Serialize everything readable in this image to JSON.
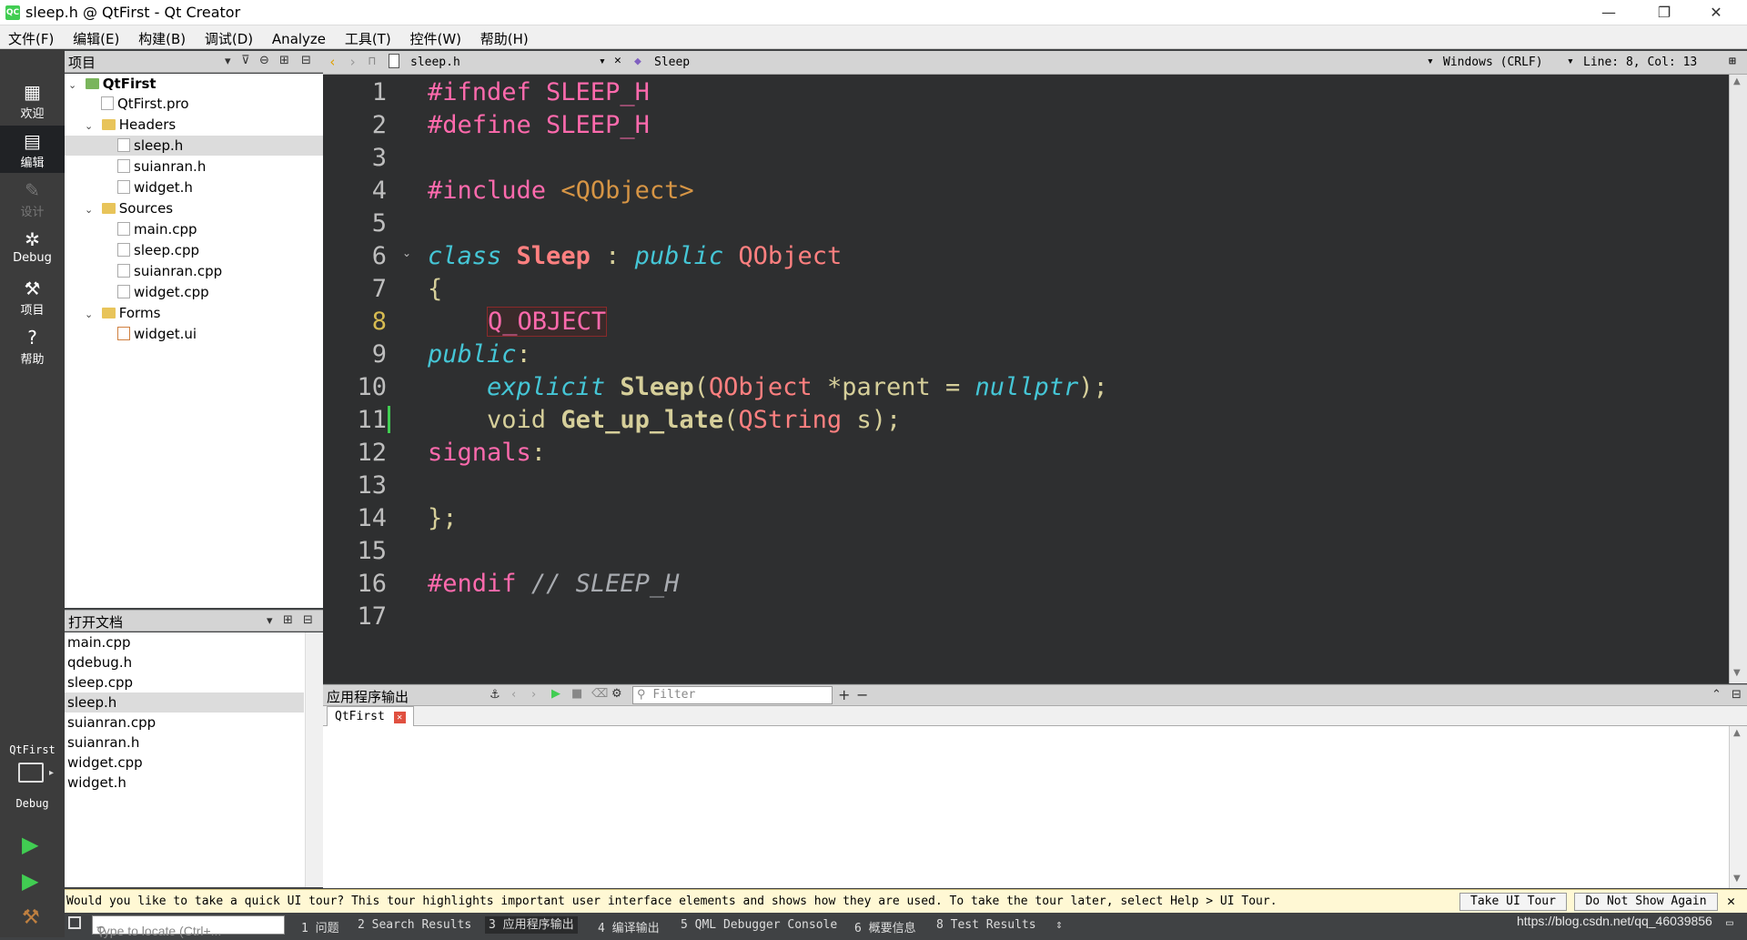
{
  "window": {
    "title": "sleep.h @ QtFirst - Qt Creator",
    "app_icon": "QC",
    "minimize": "—",
    "restore": "❐",
    "close": "✕"
  },
  "menu": [
    "文件(F)",
    "编辑(E)",
    "构建(B)",
    "调试(D)",
    "Analyze",
    "工具(T)",
    "控件(W)",
    "帮助(H)"
  ],
  "modes": [
    {
      "label": "欢迎",
      "icon": "grid-icon"
    },
    {
      "label": "编辑",
      "icon": "edit-icon"
    },
    {
      "label": "设计",
      "icon": "pencil-icon"
    },
    {
      "label": "Debug",
      "icon": "bug-icon"
    },
    {
      "label": "项目",
      "icon": "wrench-icon"
    },
    {
      "label": "帮助",
      "icon": "help-icon"
    }
  ],
  "kit": {
    "project": "QtFirst",
    "build": "Debug"
  },
  "project_panel": {
    "title": "项目"
  },
  "tree": [
    {
      "label": "QtFirst",
      "level": 0,
      "kind": "project",
      "expanded": true
    },
    {
      "label": "QtFirst.pro",
      "level": 1,
      "kind": "file"
    },
    {
      "label": "Headers",
      "level": 1,
      "kind": "folder",
      "expanded": true
    },
    {
      "label": "sleep.h",
      "level": 2,
      "kind": "file",
      "selected": true
    },
    {
      "label": "suianran.h",
      "level": 2,
      "kind": "file"
    },
    {
      "label": "widget.h",
      "level": 2,
      "kind": "file"
    },
    {
      "label": "Sources",
      "level": 1,
      "kind": "folder",
      "expanded": true
    },
    {
      "label": "main.cpp",
      "level": 2,
      "kind": "file"
    },
    {
      "label": "sleep.cpp",
      "level": 2,
      "kind": "file"
    },
    {
      "label": "suianran.cpp",
      "level": 2,
      "kind": "file"
    },
    {
      "label": "widget.cpp",
      "level": 2,
      "kind": "file"
    },
    {
      "label": "Forms",
      "level": 1,
      "kind": "folder",
      "expanded": true
    },
    {
      "label": "widget.ui",
      "level": 2,
      "kind": "form"
    }
  ],
  "open_docs": {
    "title": "打开文档",
    "items": [
      "main.cpp",
      "qdebug.h",
      "sleep.cpp",
      "sleep.h",
      "suianran.cpp",
      "suianran.h",
      "widget.cpp",
      "widget.h"
    ],
    "selected": "sleep.h"
  },
  "editor": {
    "file": "sleep.h",
    "symbol": "Sleep",
    "encoding": "Windows (CRLF)",
    "position": "Line: 8, Col: 13",
    "current_line": 8
  },
  "code_lines": [
    [
      [
        "pp",
        "#ifndef SLEEP_H"
      ]
    ],
    [
      [
        "pp",
        "#define SLEEP_H"
      ]
    ],
    [],
    [
      [
        "pp",
        "#include "
      ],
      [
        "inc",
        "<QObject>"
      ]
    ],
    [],
    [
      [
        "kw",
        "class"
      ],
      [
        "op",
        " "
      ],
      [
        "cls",
        "Sleep"
      ],
      [
        "op",
        " : "
      ],
      [
        "kw",
        "public"
      ],
      [
        "op",
        " "
      ],
      [
        "ty",
        "QObject"
      ]
    ],
    [
      [
        "op",
        "{"
      ]
    ],
    [
      [
        "op",
        "    "
      ],
      [
        "macro",
        "Q_OBJECT"
      ]
    ],
    [
      [
        "kw",
        "public"
      ],
      [
        "op",
        ":"
      ]
    ],
    [
      [
        "op",
        "    "
      ],
      [
        "kw",
        "explicit"
      ],
      [
        "op",
        " "
      ],
      [
        "fn",
        "Sleep"
      ],
      [
        "op",
        "("
      ],
      [
        "ty",
        "QObject"
      ],
      [
        "op",
        " *parent = "
      ],
      [
        "kw",
        "nullptr"
      ],
      [
        "op",
        ");"
      ]
    ],
    [
      [
        "op",
        "    void "
      ],
      [
        "fn",
        "Get_up_late"
      ],
      [
        "op",
        "("
      ],
      [
        "ty",
        "QString"
      ],
      [
        "op",
        " s);"
      ]
    ],
    [
      [
        "pp",
        "signals"
      ],
      [
        "op",
        ":"
      ]
    ],
    [],
    [
      [
        "op",
        "};"
      ]
    ],
    [],
    [
      [
        "pp",
        "#endif"
      ],
      [
        "op",
        " "
      ],
      [
        "cm",
        "// SLEEP_H"
      ]
    ],
    []
  ],
  "output": {
    "title": "应用程序输出",
    "filter_placeholder": "Filter",
    "tab": "QtFirst"
  },
  "tour": {
    "text": "Would you like to take a quick UI tour? This tour highlights important user interface elements and shows how they are used. To take the tour later, select Help > UI Tour.",
    "take": "Take UI Tour",
    "dismiss": "Do Not Show Again"
  },
  "status": {
    "locate_placeholder": "Type to locate (Ctrl+...",
    "tabs": [
      "1 问题",
      "2 Search Results",
      "3 应用程序输出",
      "4 编译输出",
      "5 QML Debugger Console",
      "6 概要信息",
      "8 Test Results"
    ],
    "watermark": "https://blog.csdn.net/qq_46039856"
  },
  "colors": {
    "editor_bg": "#2e2f30",
    "preprocessor": "#ff6aad",
    "keyword": "#45c6d6",
    "class": "#ff8080",
    "current_line_number": "#d6bb51"
  }
}
